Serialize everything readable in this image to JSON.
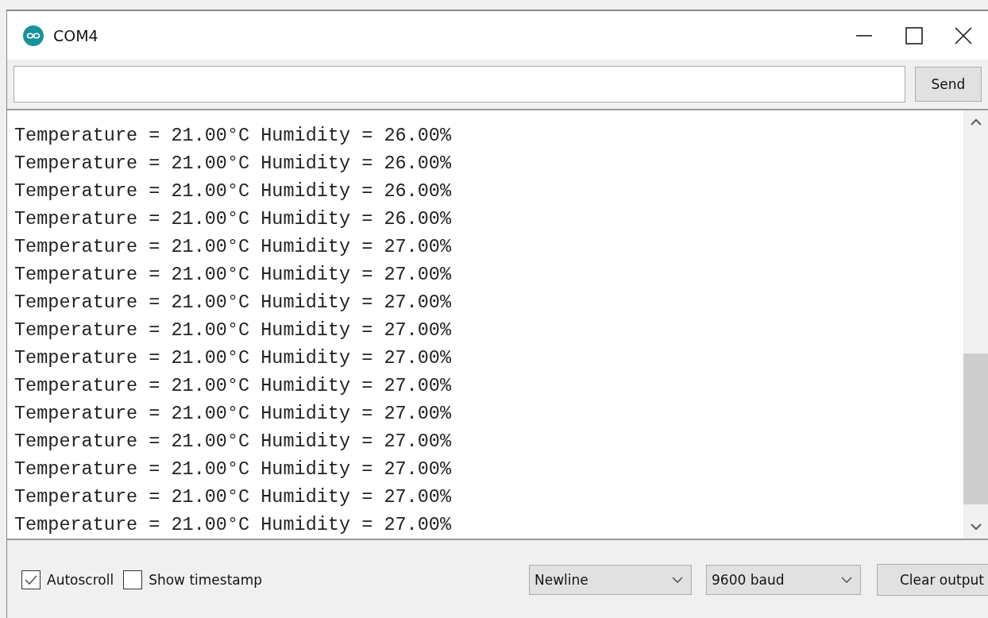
{
  "window": {
    "title": "COM4"
  },
  "send_button": "Send",
  "output_lines": [
    "Temperature = 21.00°C Humidity = 26.00%",
    "Temperature = 21.00°C Humidity = 26.00%",
    "Temperature = 21.00°C Humidity = 26.00%",
    "Temperature = 21.00°C Humidity = 26.00%",
    "Temperature = 21.00°C Humidity = 27.00%",
    "Temperature = 21.00°C Humidity = 27.00%",
    "Temperature = 21.00°C Humidity = 27.00%",
    "Temperature = 21.00°C Humidity = 27.00%",
    "Temperature = 21.00°C Humidity = 27.00%",
    "Temperature = 21.00°C Humidity = 27.00%",
    "Temperature = 21.00°C Humidity = 27.00%",
    "Temperature = 21.00°C Humidity = 27.00%",
    "Temperature = 21.00°C Humidity = 27.00%",
    "Temperature = 21.00°C Humidity = 27.00%",
    "Temperature = 21.00°C Humidity = 27.00%"
  ],
  "options": [
    {
      "label": "Autoscroll",
      "checked": true
    },
    {
      "label": "Show timestamp",
      "checked": false
    }
  ],
  "line_ending": "Newline",
  "baud_rate": "9600 baud",
  "clear_button": "Clear output"
}
